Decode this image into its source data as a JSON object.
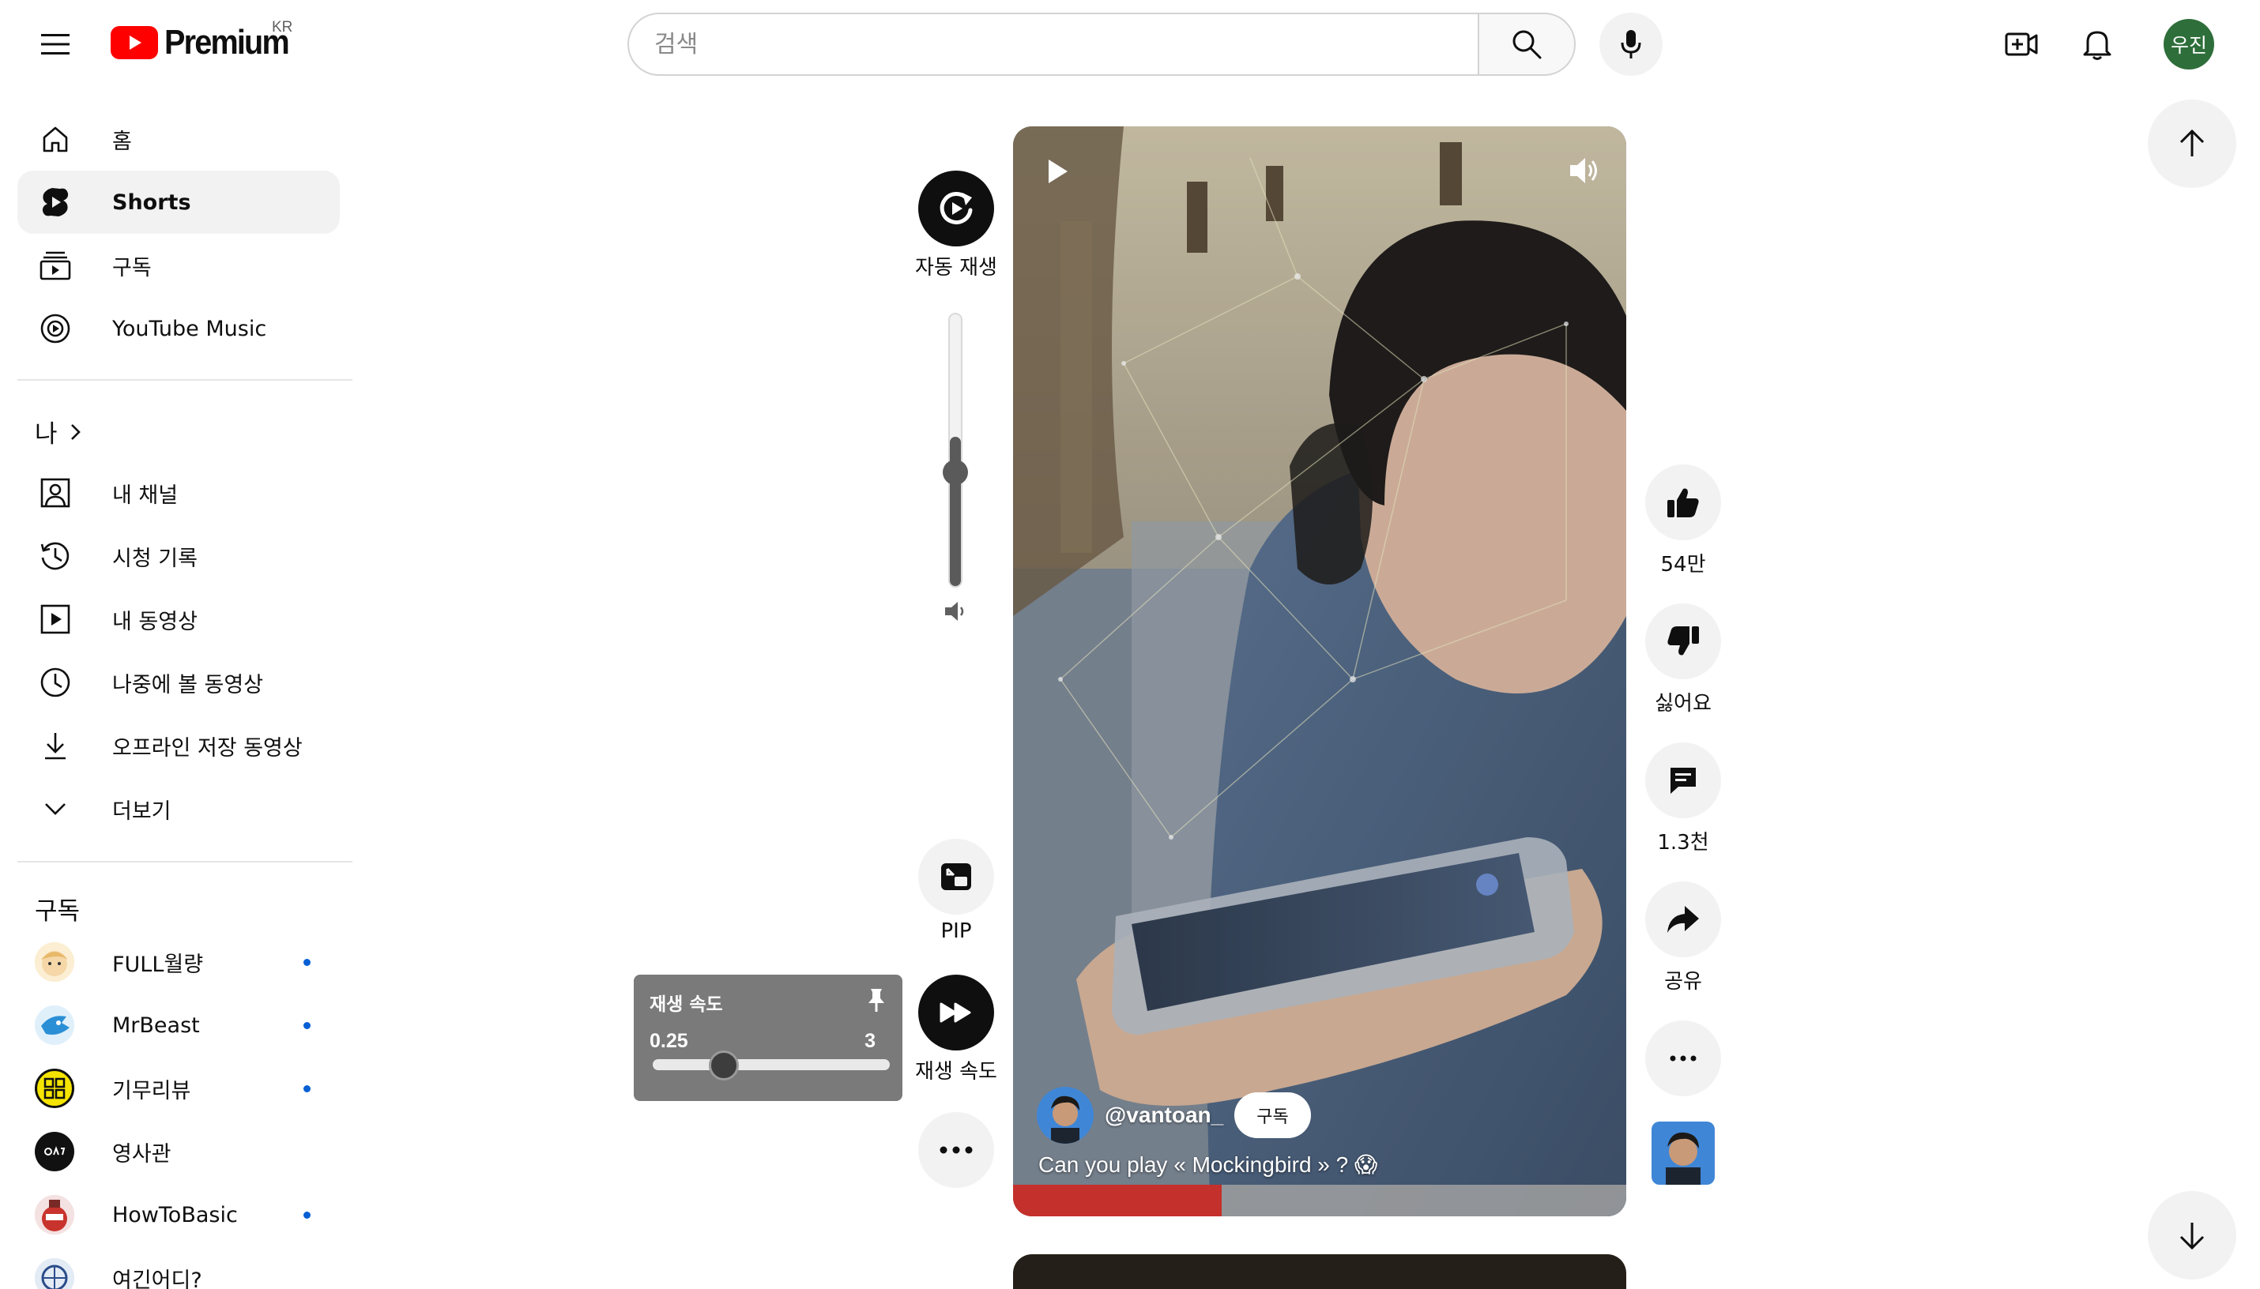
{
  "header": {
    "logo_text": "Premium",
    "region": "KR",
    "search_placeholder": "검색",
    "avatar_initials": "우진"
  },
  "sidebar": {
    "main_items": [
      {
        "label": "홈",
        "icon": "home-icon"
      },
      {
        "label": "Shorts",
        "icon": "shorts-icon",
        "active": true
      },
      {
        "label": "구독",
        "icon": "subscriptions-icon"
      },
      {
        "label": "YouTube Music",
        "icon": "youtube-music-icon"
      }
    ],
    "you_section": {
      "title": "나",
      "items": [
        {
          "label": "내 채널",
          "icon": "your-channel-icon"
        },
        {
          "label": "시청 기록",
          "icon": "history-icon"
        },
        {
          "label": "내 동영상",
          "icon": "your-videos-icon"
        },
        {
          "label": "나중에 볼 동영상",
          "icon": "watch-later-icon"
        },
        {
          "label": "오프라인 저장 동영상",
          "icon": "downloads-icon"
        },
        {
          "label": "더보기",
          "icon": "chevron-down-icon"
        }
      ]
    },
    "subscriptions": {
      "title": "구독",
      "items": [
        {
          "label": "FULL월량",
          "new": true
        },
        {
          "label": "MrBeast",
          "new": true
        },
        {
          "label": "기무리뷰",
          "new": true
        },
        {
          "label": "영사관",
          "new": false
        },
        {
          "label": "HowToBasic",
          "new": true
        },
        {
          "label": "여긴어디?",
          "new": false
        }
      ]
    }
  },
  "controls": {
    "autoplay_label": "자동 재생",
    "volume_level": 0.55,
    "pip_label": "PIP",
    "speed_label": "재생 속도",
    "speed_popup": {
      "title": "재생 속도",
      "min": "0.25",
      "max": "3",
      "value_fraction": 0.3
    }
  },
  "video": {
    "channel": "@vantoan_",
    "subscribe_label": "구독",
    "caption": "Can you play « Mockingbird » ? 😱",
    "progress": 0.34
  },
  "actions": {
    "like_count": "54만",
    "dislike_label": "싫어요",
    "comment_count": "1.3천",
    "share_label": "공유"
  },
  "colors": {
    "brand_red": "#ff0000",
    "progress_red": "#c4302b",
    "avatar_green": "#2e6e3a",
    "new_dot": "#065fd4"
  }
}
